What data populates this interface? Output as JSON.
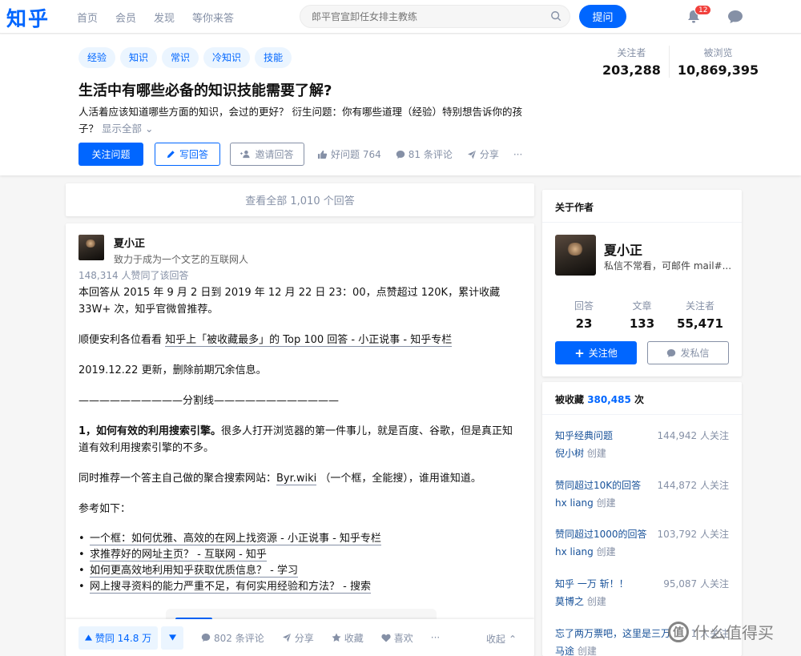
{
  "brand": {
    "logo": "知乎",
    "accent": "#0066ff"
  },
  "nav": {
    "items": [
      "首页",
      "会员",
      "发现",
      "等你来答"
    ]
  },
  "search": {
    "placeholder": "郎平官宣卸任女排主教练"
  },
  "header": {
    "ask_label": "提问",
    "notification_count": "12"
  },
  "question": {
    "topics": [
      "经验",
      "知识",
      "常识",
      "冷知识",
      "技能"
    ],
    "title": "生活中有哪些必备的知识技能需要了解?",
    "detail": "人活着应该知道哪些方面的知识，会过的更好？ 衍生问题：你有哪些道理（经验）特别想告诉你的孩子？",
    "show_all": "显示全部",
    "follow_label": "关注问题",
    "answer_label": "写回答",
    "invite_label": "邀请回答",
    "good_question": "好问题 764",
    "comments": "81 条评论",
    "share": "分享",
    "more": "···",
    "followers_label": "关注者",
    "followers": "203,288",
    "views_label": "被浏览",
    "views": "10,869,395"
  },
  "view_all": "查看全部 1,010 个回答",
  "answer": {
    "author": "夏小正",
    "bio": "致力于成为一个文艺的互联网人",
    "votes_line": "148,314 人赞同了该回答",
    "p1": "本回答从 2015 年 9 月 2 日到 2019 年 12 月 22 日 23：00，点赞超过 120K，累计收藏 33W+ 次，知乎官微曾推荐。",
    "p2_pre": "顺便安利各位看看 ",
    "p2_link": "知乎上「被收藏最多」的 Top 100 回答 - 小正说事 - 知乎专栏",
    "p3": "2019.12.22 更新，删除前期冗余信息。",
    "p4": "——————————分割线————————————",
    "p5_bold": "1，如何有效的利用搜索引擎。",
    "p5_rest": "很多人打开浏览器的第一件事儿，就是百度、谷歌，但是真正知道有效利用搜索引擎的不多。",
    "p6_pre": "同时推荐一个答主自己做的聚合搜索网站：",
    "p6_link": "Byr.wiki",
    "p6_post": " （一个框，全能搜），谁用谁知道。",
    "p7": "参考如下：",
    "links": [
      "一个框：如何优雅、高效的在网上找资源 - 小正说事 - 知乎专栏",
      "求推荐好的网址主页？ - 互联网 - 知乎",
      "如何更高效地利用知乎获取优质信息？ - 学习",
      "网上搜寻资料的能力严重不足，有何实用经验和方法？ - 搜索"
    ],
    "vote_label": "赞同 14.8 万",
    "comments": "802 条评论",
    "share": "分享",
    "collect": "收藏",
    "like": "喜欢",
    "more": "···",
    "collapse": "收起"
  },
  "sidebar": {
    "about_title": "关于作者",
    "name": "夏小正",
    "bio": "私信不常看，可邮件 mail#...",
    "answers_label": "回答",
    "answers": "23",
    "articles_label": "文章",
    "articles": "133",
    "followers_label": "关注者",
    "followers": "55,471",
    "follow_label": "关注他",
    "message_label": "发私信",
    "collected_label": "被收藏",
    "collected_count": "380,485",
    "collected_suffix": "次",
    "collections": [
      {
        "title": "知乎经典问题",
        "follows": "144,942 人关注",
        "creator": "倪小树",
        "created": "创建"
      },
      {
        "title": "赞同超过10K的回答",
        "follows": "144,872 人关注",
        "creator": "hx liang",
        "created": "创建"
      },
      {
        "title": "赞同超过1000的回答",
        "follows": "103,792 人关注",
        "creator": "hx liang",
        "created": "创建"
      },
      {
        "title": "知乎 一万 斩！！",
        "follows": "95,087 人关注",
        "creator": "莫博之",
        "created": "创建"
      },
      {
        "title": "忘了两万票吧，这里是三万",
        "follows": "1 人关注",
        "creator": "马途",
        "created": "创建"
      }
    ]
  },
  "watermark": {
    "mark": "值",
    "text": "什么值得买"
  }
}
